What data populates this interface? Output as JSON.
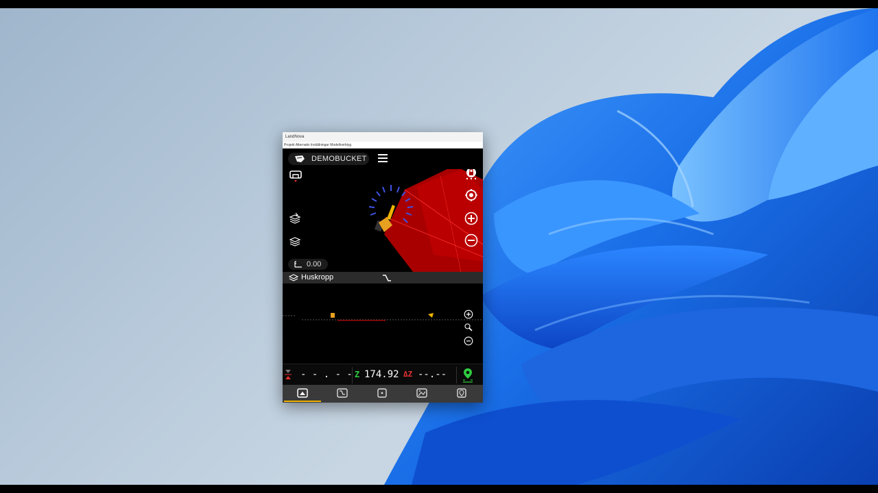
{
  "window": {
    "title": "LandNova",
    "menu": [
      "Projekt",
      "Alternativ",
      "Inställningar",
      "Modellverktyg"
    ]
  },
  "header": {
    "machine_name": "DEMOBUCKET"
  },
  "plan_view": {
    "elevation_offset": "0.00"
  },
  "surface": {
    "name": "Huskropp"
  },
  "status": {
    "cut_fill_value": "- - . - -",
    "z_label": "Z",
    "z_value": "174.92",
    "delta_z_label": "ΔZ",
    "delta_z_value": "--.--"
  },
  "nav": {
    "tabs": [
      "plan-view",
      "profile-view",
      "point-view",
      "surface-view",
      "location-view"
    ],
    "active": "plan-view"
  },
  "colors": {
    "accent": "#f0b400",
    "design_surface": "#b00000",
    "z_label": "#2ecc40",
    "delta_z_label": "#e53030",
    "gps_ok": "#2ecc40"
  }
}
